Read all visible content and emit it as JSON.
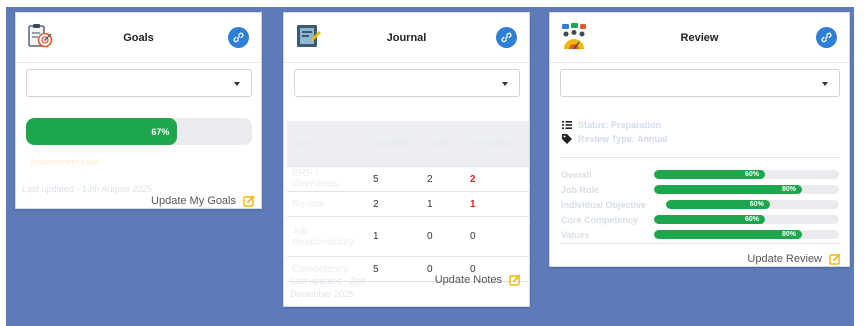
{
  "goals": {
    "title": "Goals",
    "progress_percent": 67,
    "progress_label": "67%",
    "last_updated": "Last updated - 13th August 2025",
    "update_link": "Update My Goals",
    "faint_status": "Assessment Late"
  },
  "journal": {
    "title": "Journal",
    "columns": [
      "Type",
      "Total Notes",
      "Issues",
      "Unresolved"
    ],
    "rows": [
      {
        "type": "PRR / Overviews",
        "total": "5",
        "issues": "2",
        "unresolved": "2",
        "unresolved_red": true
      },
      {
        "type": "Review",
        "total": "2",
        "issues": "1",
        "unresolved": "1",
        "unresolved_red": true
      },
      {
        "type": "Job Responsibility",
        "total": "1",
        "issues": "0",
        "unresolved": "0",
        "unresolved_red": false
      },
      {
        "type": "Competency",
        "total": "5",
        "issues": "0",
        "unresolved": "0",
        "unresolved_red": false
      }
    ],
    "last_updated": "Last updated - 2nd December 2025",
    "update_link": "Update Notes"
  },
  "review": {
    "title": "Review",
    "status_label": "Status: Preparation",
    "type_label": "Review Type: Annual",
    "bars": [
      {
        "label": "Overall",
        "value": 60,
        "text": "60%"
      },
      {
        "label": "Job Role",
        "value": 80,
        "text": "80%"
      },
      {
        "label": "Individual Objective",
        "value": 60,
        "text": "60%"
      },
      {
        "label": "Core Competency",
        "value": 60,
        "text": "60%"
      },
      {
        "label": "Values",
        "value": 80,
        "text": "80%"
      }
    ],
    "update_link": "Update Review"
  },
  "colors": {
    "background": "#5d7bb8",
    "accent_blue": "#2f7fd6",
    "progress_green": "#1ea64c",
    "alert_red": "#e02020",
    "edit_yellow": "#f2b705"
  },
  "icons": [
    "clipboard-goal-icon",
    "journal-icon",
    "review-team-icon",
    "link-icon",
    "edit-icon",
    "list-icon",
    "tag-icon",
    "chevron-down-icon"
  ]
}
